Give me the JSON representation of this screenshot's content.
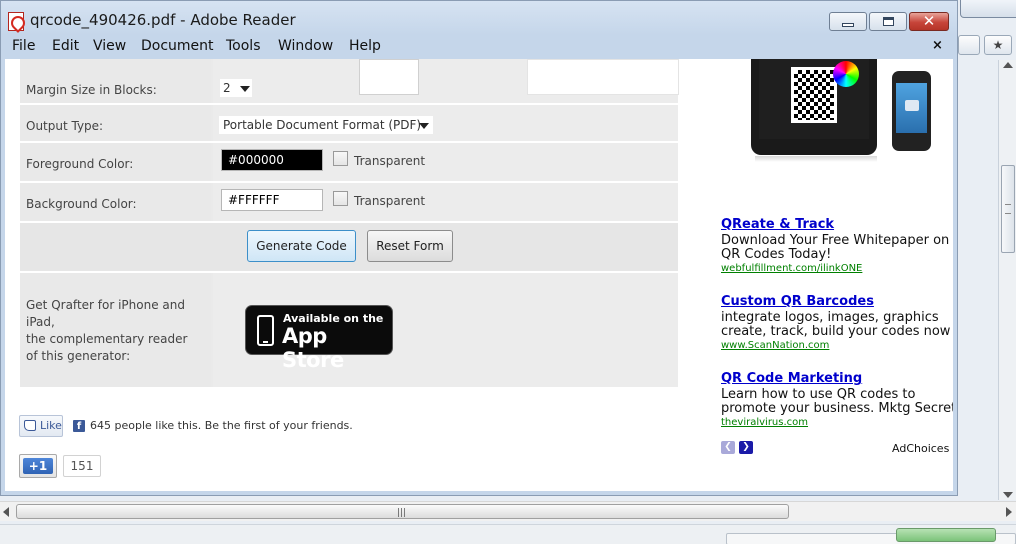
{
  "window": {
    "title": "qrcode_490426.pdf - Adobe Reader",
    "minimize_icon": "minimize-icon",
    "maximize_icon": "maximize-icon",
    "close_glyph": "✕"
  },
  "menubar": {
    "items": [
      "File",
      "Edit",
      "View",
      "Document",
      "Tools",
      "Window",
      "Help"
    ],
    "close_doc_glyph": "×"
  },
  "form": {
    "margin": {
      "label": "Margin Size in Blocks:",
      "value": "2"
    },
    "output": {
      "label": "Output Type:",
      "value": "Portable Document Format (PDF)"
    },
    "foreground": {
      "label": "Foreground Color:",
      "value": "#000000",
      "transparent_label": "Transparent",
      "transparent_checked": false,
      "swatch": "#000000",
      "text_color": "#ffffff"
    },
    "background": {
      "label": "Background Color:",
      "value": "#FFFFFF",
      "transparent_label": "Transparent",
      "transparent_checked": false,
      "swatch": "#FFFFFF",
      "text_color": "#000000"
    },
    "generate_label": "Generate Code",
    "reset_label": "Reset Form",
    "qrafter_text": [
      "Get Qrafter for iPhone and",
      "iPad,",
      "the complementary reader",
      "of this generator:"
    ],
    "appstore": {
      "line1": "Available on the",
      "line2": "App Store"
    }
  },
  "social": {
    "like_label": "Like",
    "fb_text": "645 people like this. Be the first of your friends.",
    "gplus_label": "+1",
    "gplus_count": "151"
  },
  "ads": [
    {
      "title": "QReate & Track",
      "text": [
        "Download Your Free Whitepaper on",
        "QR Codes Today!"
      ],
      "url": "webfulfillment.com/ilinkONE"
    },
    {
      "title": "Custom QR Barcodes",
      "text": [
        "integrate logos, images, graphics",
        "create, track, build your codes now"
      ],
      "url": "www.ScanNation.com"
    },
    {
      "title": "QR Code Marketing",
      "text": [
        "Learn how to use QR codes to",
        "promote your business. Mktg Secrets"
      ],
      "url": "theviralvirus.com"
    }
  ],
  "ad_nav": {
    "prev": "❮",
    "next": "❯"
  },
  "adchoices": "AdChoices",
  "hscroll_grip": "|||",
  "colors": {
    "reader_frame": "#c5d6ea",
    "link": "#0000cc",
    "url": "#008000",
    "form_bg": "#eaeaea"
  }
}
